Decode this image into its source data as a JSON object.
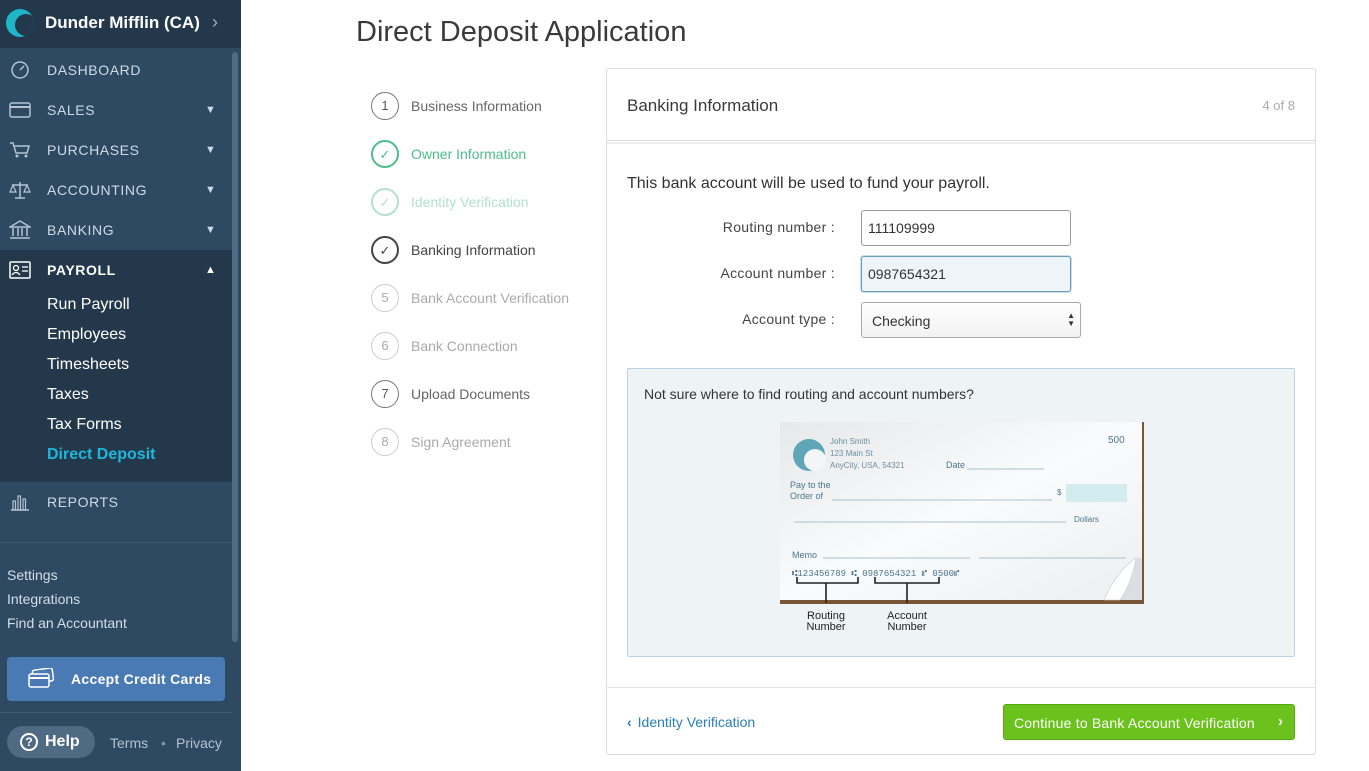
{
  "sidebar": {
    "company": "Dunder Mifflin (CA)",
    "nav": [
      {
        "label": "DASHBOARD",
        "icon": "dashboard-icon"
      },
      {
        "label": "SALES",
        "icon": "card-icon"
      },
      {
        "label": "PURCHASES",
        "icon": "cart-icon"
      },
      {
        "label": "ACCOUNTING",
        "icon": "scale-icon"
      },
      {
        "label": "BANKING",
        "icon": "bank-icon"
      },
      {
        "label": "PAYROLL",
        "icon": "payroll-icon"
      },
      {
        "label": "REPORTS",
        "icon": "reports-icon"
      }
    ],
    "payroll_sub": [
      "Run Payroll",
      "Employees",
      "Timesheets",
      "Taxes",
      "Tax Forms",
      "Direct Deposit"
    ],
    "links": [
      "Settings",
      "Integrations",
      "Find an Accountant"
    ],
    "accept_cards": "Accept Credit Cards",
    "help": "Help",
    "terms": "Terms",
    "privacy": "Privacy"
  },
  "main": {
    "title": "Direct Deposit Application",
    "steps": [
      {
        "num": "1",
        "label": "Business Information"
      },
      {
        "num": "",
        "label": "Owner Information"
      },
      {
        "num": "",
        "label": "Identity Verification"
      },
      {
        "num": "",
        "label": "Banking Information"
      },
      {
        "num": "5",
        "label": "Bank Account Verification"
      },
      {
        "num": "6",
        "label": "Bank Connection"
      },
      {
        "num": "7",
        "label": "Upload Documents"
      },
      {
        "num": "8",
        "label": "Sign Agreement"
      }
    ],
    "card": {
      "title": "Banking Information",
      "progress": "4 of 8",
      "intro": "This bank account will be used to fund your payroll.",
      "routing_label": "Routing number :",
      "routing_value": "111109999",
      "account_label": "Account number :",
      "account_value": "0987654321",
      "type_label": "Account type :",
      "type_value": "Checking",
      "hint_question": "Not sure where to find routing and account numbers?",
      "check": {
        "name": "John Smith",
        "address1": "123 Main St",
        "address2": "AnyCity, USA, 54321",
        "number": "500",
        "date": "Date",
        "pay_to_1": "Pay to the",
        "pay_to_2": "Order of",
        "dollar": "$",
        "dollars": "Dollars",
        "memo": "Memo",
        "micr": "⑆123456789 ⑆ 0987654321 ⑈ 0500⑈",
        "routing_caption_1": "Routing",
        "routing_caption_2": "Number",
        "account_caption_1": "Account",
        "account_caption_2": "Number"
      },
      "back_label": "Identity Verification",
      "continue_label": "Continue to Bank Account Verification"
    }
  },
  "colors": {
    "sidebar": "#2e4a62",
    "accent": "#1fb6d9",
    "success": "#4dbd8a",
    "primary_button": "#6bc21d",
    "link": "#2a7fb8"
  }
}
